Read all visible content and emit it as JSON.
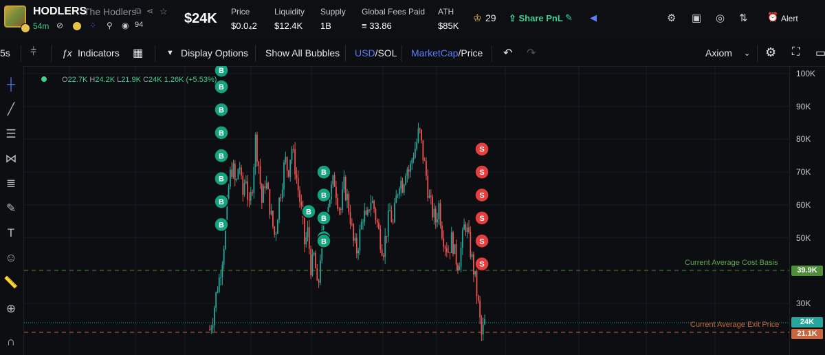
{
  "header": {
    "ticker": "HODLERS",
    "name": "The Hodlers",
    "age": "54m",
    "holders_count": "94",
    "price_big": "$24K",
    "stats": [
      {
        "label": "Price",
        "value": "$0.0₄2"
      },
      {
        "label": "Liquidity",
        "value": "$12.4K"
      },
      {
        "label": "Supply",
        "value": "1B"
      },
      {
        "label": "Global Fees Paid",
        "value": "≡ 33.86"
      },
      {
        "label": "ATH",
        "value": "$85K"
      }
    ],
    "crown_count": "29",
    "share_label": "Share PnL",
    "alert_label": "Alert"
  },
  "toolbar": {
    "interval": "5s",
    "indicators": "Indicators",
    "display_options": "Display Options",
    "show_bubbles": "Show All Bubbles",
    "usd": "USD",
    "sol": "/SOL",
    "marketcap": "MarketCap",
    "price": "/Price",
    "axiom": "Axiom"
  },
  "ohlc": {
    "o_label": "O",
    "o": "22.7K",
    "h_label": "H",
    "h": "24.2K",
    "l_label": "L",
    "l": "21.9K",
    "c_label": "C",
    "c": "24K",
    "change": "1.26K (+5.53%)"
  },
  "lines": {
    "cost_label": "Current Average Cost Basis",
    "cost_value": "39.9K",
    "exit_label": "Current Average Exit Price",
    "exit_value": "21.1K",
    "current_value": "24K"
  },
  "colors": {
    "up": "#26a69a",
    "down": "#ef5350",
    "buy": "#14a37f",
    "sell": "#e53e3e",
    "accent": "#5b7cfa",
    "green": "#3fcf8e"
  },
  "chart_data": {
    "type": "candlestick",
    "y_ticks": [
      "100K",
      "90K",
      "80K",
      "70K",
      "60K",
      "50K",
      "30K"
    ],
    "ylim": [
      20000,
      102000
    ],
    "close_path": [
      22000,
      26000,
      33000,
      38000,
      45000,
      55000,
      68000,
      72000,
      65000,
      74000,
      62000,
      70000,
      58000,
      66000,
      80000,
      72000,
      60000,
      68000,
      62000,
      55000,
      50000,
      60000,
      66000,
      74000,
      70000,
      78000,
      72000,
      65000,
      58000,
      48000,
      52000,
      40000,
      45000,
      32000,
      48000,
      55000,
      60000,
      64000,
      68000,
      62000,
      58000,
      66000,
      62000,
      56000,
      48000,
      46000,
      52000,
      58000,
      54000,
      62000,
      60000,
      55000,
      50000,
      46000,
      52000,
      58000,
      54000,
      62000,
      68000,
      66000,
      72000,
      70000,
      75000,
      78000,
      83000,
      76000,
      70000,
      62000,
      58000,
      55000,
      60000,
      52000,
      48000,
      46000,
      50000,
      44000,
      42000,
      48000,
      55000,
      50000,
      44000,
      38000,
      30000,
      20000,
      24000
    ],
    "buys": [
      101000,
      96000,
      89000,
      82000,
      75000,
      68000,
      61000,
      54000,
      70000,
      63000,
      56000,
      58000,
      50000,
      49000
    ],
    "sells": [
      77000,
      70000,
      63000,
      56000,
      49000,
      42000
    ]
  }
}
